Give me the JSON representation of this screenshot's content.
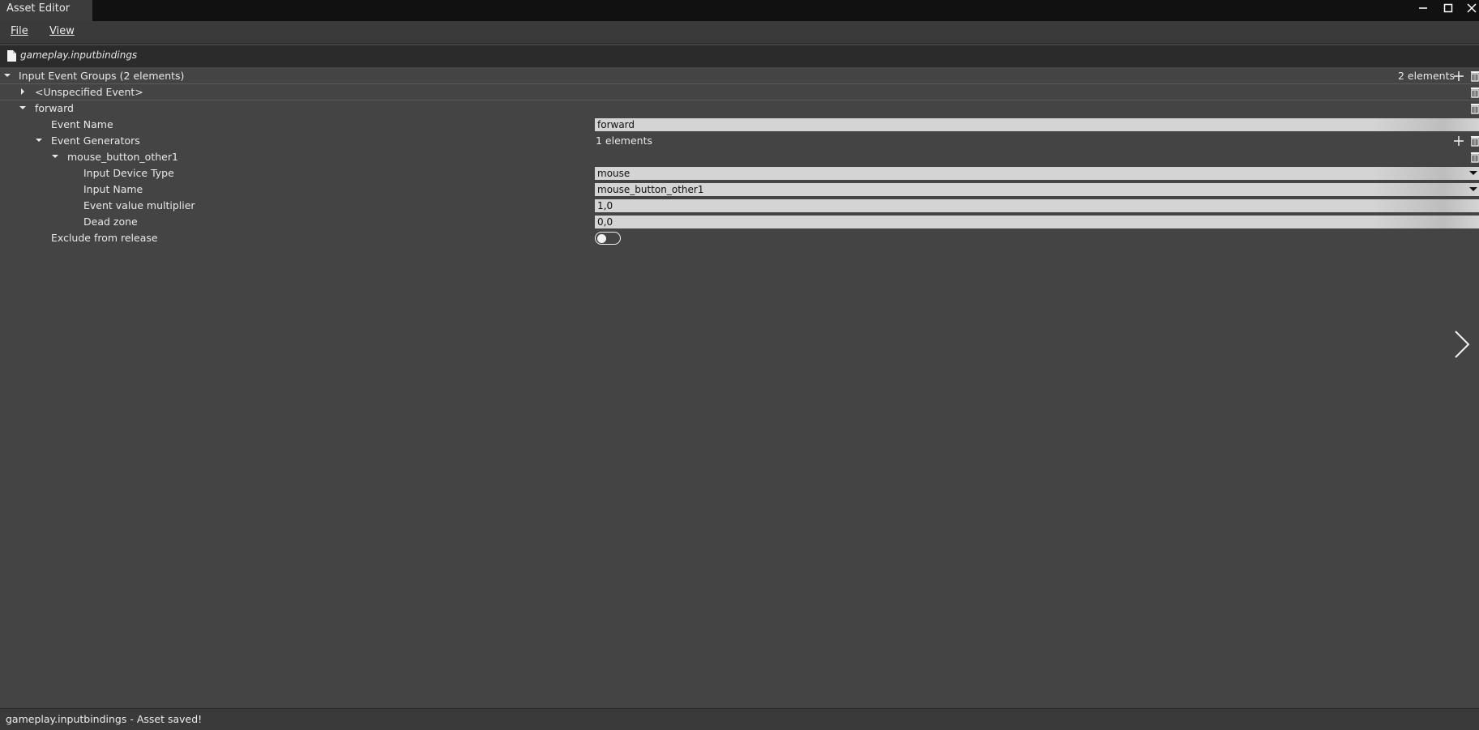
{
  "window": {
    "title": "Asset Editor",
    "minimize_glyph": "–",
    "maximize_glyph": "□",
    "close_glyph": "✕"
  },
  "menu": {
    "file_label": "File",
    "view_label": "View"
  },
  "file_tab": {
    "name": "gameplay.inputbindings"
  },
  "tree": {
    "root": {
      "label": "Input Event Groups (2 elements)",
      "count": "2 elements"
    },
    "unspecified": {
      "label": "<Unspecified Event>"
    },
    "forward": {
      "label": "forward",
      "event_name_label": "Event Name",
      "event_name_value": "forward",
      "event_generators_label": "Event Generators",
      "event_generators_count": "1 elements",
      "generator": {
        "label": "mouse_button_other1",
        "input_device_type_label": "Input Device Type",
        "input_device_type_value": "mouse",
        "input_name_label": "Input Name",
        "input_name_value": "mouse_button_other1",
        "multiplier_label": "Event value multiplier",
        "multiplier_value": "1,0",
        "dead_zone_label": "Dead zone",
        "dead_zone_value": "0,0"
      },
      "exclude_label": "Exclude from release",
      "exclude_value": false
    }
  },
  "status": {
    "text": "gameplay.inputbindings - Asset saved!"
  },
  "colors": {
    "background": "#444444",
    "titlebar": "#111111",
    "field": "#d4d4d4"
  }
}
